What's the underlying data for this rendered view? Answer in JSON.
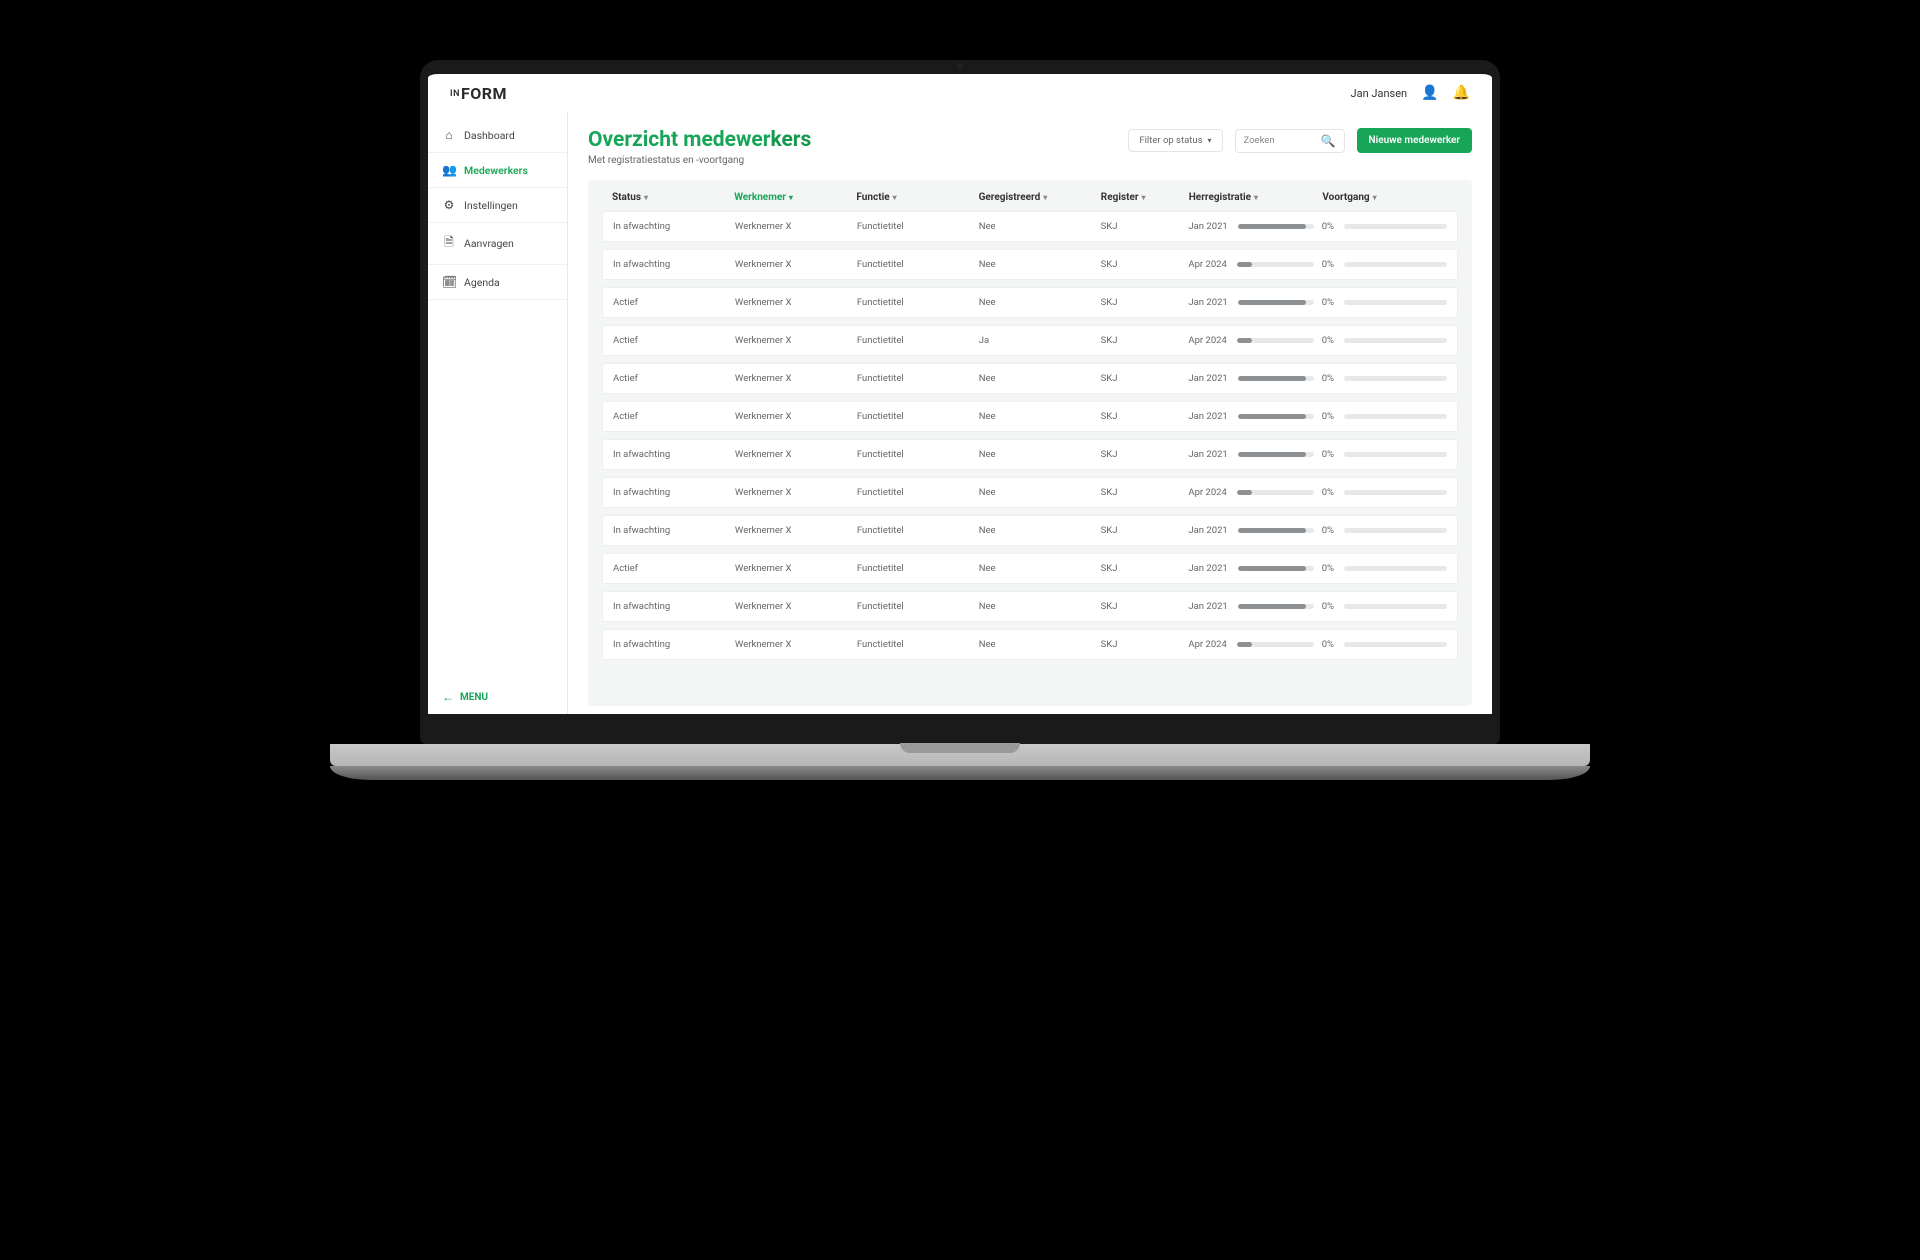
{
  "brand": {
    "prefix": "IN",
    "main": "FORM"
  },
  "user_name": "Jan Jansen",
  "sidebar": {
    "items": [
      {
        "icon": "⌂",
        "label": "Dashboard"
      },
      {
        "icon": "👥",
        "label": "Medewerkers"
      },
      {
        "icon": "⚙",
        "label": "Instellingen"
      },
      {
        "icon": "🗎",
        "label": "Aanvragen"
      },
      {
        "icon": "🗓",
        "label": "Agenda"
      }
    ],
    "menu_label": "MENU"
  },
  "page": {
    "title_light": "Overzicht medewer",
    "title_bold": "kers",
    "subtitle": "Met registratiestatus en -voortgang"
  },
  "controls": {
    "filter_label": "Filter op status",
    "search_placeholder": "Zoeken",
    "new_button": "Nieuwe medewerker"
  },
  "columns": {
    "status": "Status",
    "werknemer": "Werknemer",
    "functie": "Functie",
    "geregistreerd": "Geregistreerd",
    "register": "Register",
    "herregistratie": "Herregistratie",
    "voortgang": "Voortgang"
  },
  "rows": [
    {
      "status": "In afwachting",
      "werknemer": "Werknemer X",
      "functie": "Functietitel",
      "geregistreerd": "Nee",
      "register": "SKJ",
      "herreg_label": "Jan 2021",
      "herreg_fill": 90,
      "voortgang_pct": "0%",
      "voortgang_fill": 0
    },
    {
      "status": "In afwachting",
      "werknemer": "Werknemer X",
      "functie": "Functietitel",
      "geregistreerd": "Nee",
      "register": "SKJ",
      "herreg_label": "Apr 2024",
      "herreg_fill": 20,
      "voortgang_pct": "0%",
      "voortgang_fill": 0
    },
    {
      "status": "Actief",
      "werknemer": "Werknemer X",
      "functie": "Functietitel",
      "geregistreerd": "Nee",
      "register": "SKJ",
      "herreg_label": "Jan 2021",
      "herreg_fill": 90,
      "voortgang_pct": "0%",
      "voortgang_fill": 0
    },
    {
      "status": "Actief",
      "werknemer": "Werknemer X",
      "functie": "Functietitel",
      "geregistreerd": "Ja",
      "register": "SKJ",
      "herreg_label": "Apr 2024",
      "herreg_fill": 20,
      "voortgang_pct": "0%",
      "voortgang_fill": 0
    },
    {
      "status": "Actief",
      "werknemer": "Werknemer X",
      "functie": "Functietitel",
      "geregistreerd": "Nee",
      "register": "SKJ",
      "herreg_label": "Jan 2021",
      "herreg_fill": 90,
      "voortgang_pct": "0%",
      "voortgang_fill": 0
    },
    {
      "status": "Actief",
      "werknemer": "Werknemer X",
      "functie": "Functietitel",
      "geregistreerd": "Nee",
      "register": "SKJ",
      "herreg_label": "Jan 2021",
      "herreg_fill": 90,
      "voortgang_pct": "0%",
      "voortgang_fill": 0
    },
    {
      "status": "In afwachting",
      "werknemer": "Werknemer X",
      "functie": "Functietitel",
      "geregistreerd": "Nee",
      "register": "SKJ",
      "herreg_label": "Jan 2021",
      "herreg_fill": 90,
      "voortgang_pct": "0%",
      "voortgang_fill": 0
    },
    {
      "status": "In afwachting",
      "werknemer": "Werknemer X",
      "functie": "Functietitel",
      "geregistreerd": "Nee",
      "register": "SKJ",
      "herreg_label": "Apr 2024",
      "herreg_fill": 20,
      "voortgang_pct": "0%",
      "voortgang_fill": 0
    },
    {
      "status": "In afwachting",
      "werknemer": "Werknemer X",
      "functie": "Functietitel",
      "geregistreerd": "Nee",
      "register": "SKJ",
      "herreg_label": "Jan 2021",
      "herreg_fill": 90,
      "voortgang_pct": "0%",
      "voortgang_fill": 0
    },
    {
      "status": "Actief",
      "werknemer": "Werknemer X",
      "functie": "Functietitel",
      "geregistreerd": "Nee",
      "register": "SKJ",
      "herreg_label": "Jan 2021",
      "herreg_fill": 90,
      "voortgang_pct": "0%",
      "voortgang_fill": 0
    },
    {
      "status": "In afwachting",
      "werknemer": "Werknemer X",
      "functie": "Functietitel",
      "geregistreerd": "Nee",
      "register": "SKJ",
      "herreg_label": "Jan 2021",
      "herreg_fill": 90,
      "voortgang_pct": "0%",
      "voortgang_fill": 0
    },
    {
      "status": "In afwachting",
      "werknemer": "Werknemer X",
      "functie": "Functietitel",
      "geregistreerd": "Nee",
      "register": "SKJ",
      "herreg_label": "Apr 2024",
      "herreg_fill": 20,
      "voortgang_pct": "0%",
      "voortgang_fill": 0
    }
  ]
}
